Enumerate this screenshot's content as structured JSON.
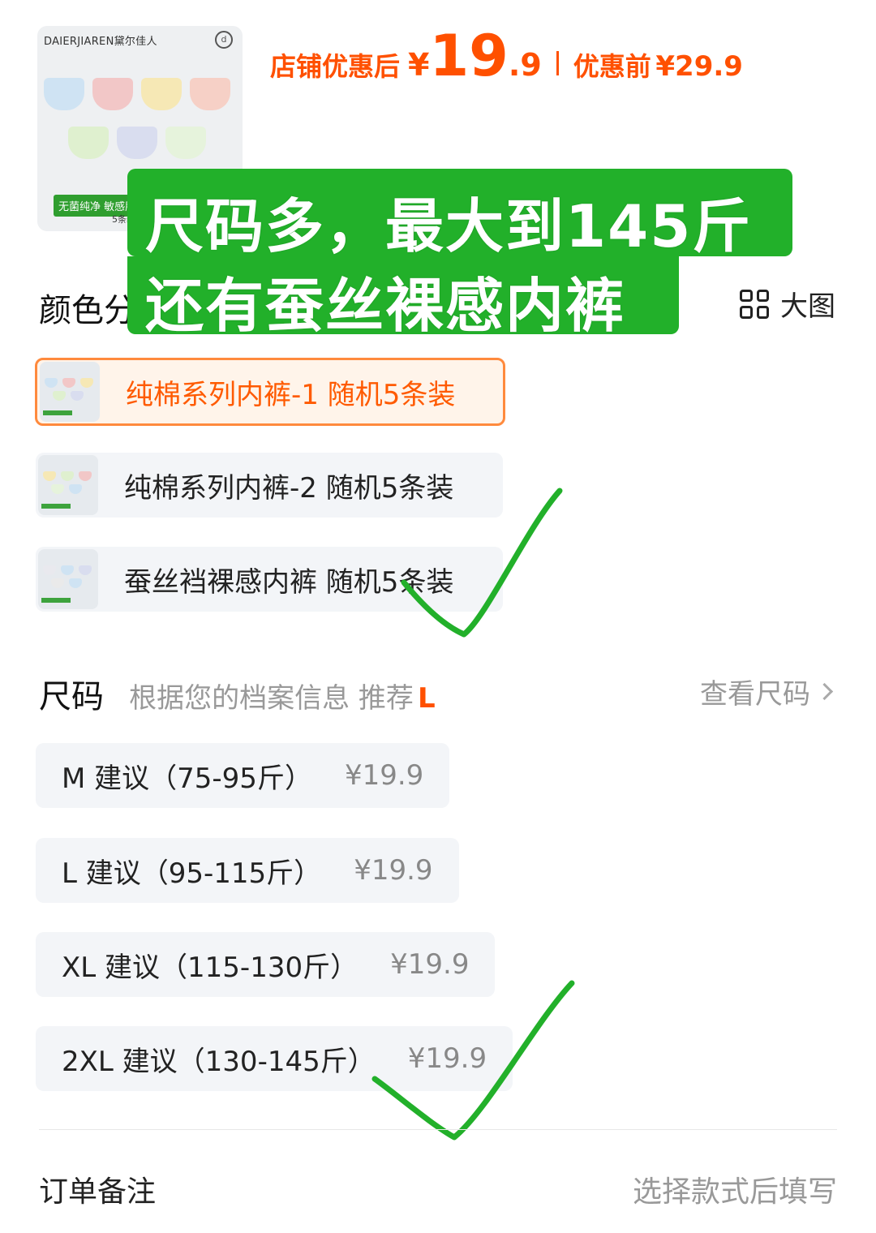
{
  "product": {
    "brand": "DAIERJIAREN黛尔佳人",
    "thumb_tag": "无菌纯净  敏感肌",
    "thumb_sub": "5条装",
    "swatches": [
      "#cfe3f3",
      "#f2c7c7",
      "#f6e8b5",
      "#f6d0c6",
      "#dff0cf",
      "#d9ddef",
      "#e6f3dc"
    ]
  },
  "price": {
    "after_label": "店铺优惠后",
    "currency": "¥",
    "int": "19",
    "dec": ".9",
    "before_label": "优惠前",
    "before_price": "¥29.9"
  },
  "overlay": {
    "line1": "尺码多，最大到145斤",
    "line2": "还有蚕丝裸感内裤"
  },
  "color_section": {
    "title": "颜色分类",
    "big_view": "大图",
    "options": [
      {
        "label": "纯棉系列内裤-1 随机5条装",
        "selected": true
      },
      {
        "label": "纯棉系列内裤-2 随机5条装",
        "selected": false
      },
      {
        "label": "蚕丝裆裸感内裤 随机5条装",
        "selected": false
      }
    ]
  },
  "size_section": {
    "title": "尺码",
    "hint": "根据您的档案信息 推荐",
    "recommended": "L",
    "chart_link": "查看尺码",
    "options": [
      {
        "label": "M 建议（75-95斤）",
        "price": "¥19.9"
      },
      {
        "label": "L 建议（95-115斤）",
        "price": "¥19.9"
      },
      {
        "label": "XL 建议（115-130斤）",
        "price": "¥19.9"
      },
      {
        "label": "2XL 建议（130-145斤）",
        "price": "¥19.9"
      }
    ]
  },
  "order_note": {
    "label": "订单备注",
    "placeholder": "选择款式后填写"
  },
  "colors": {
    "accent": "#ff5000",
    "overlay_green": "#22b02a"
  }
}
